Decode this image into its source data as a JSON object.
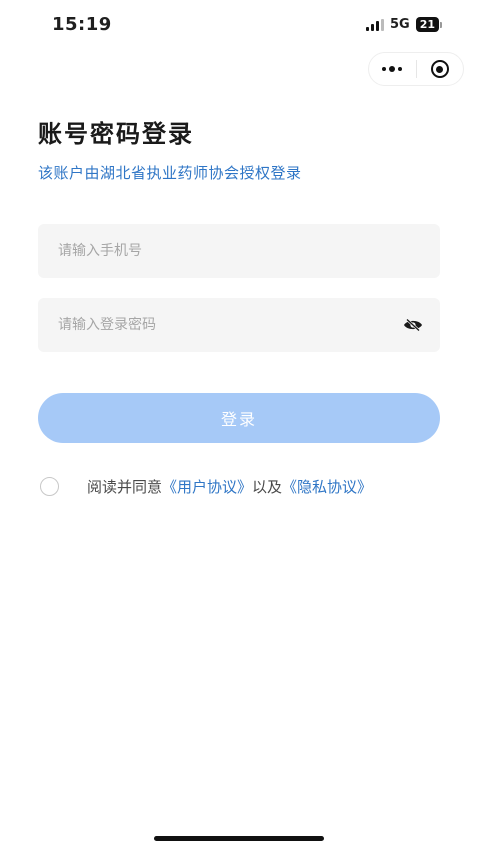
{
  "status_bar": {
    "time": "15:19",
    "network": "5G",
    "battery": "21"
  },
  "capsule": {
    "more_icon": "more-dots-icon",
    "close_icon": "target-icon"
  },
  "page": {
    "title": "账号密码登录",
    "subtitle": "该账户由湖北省执业药师协会授权登录"
  },
  "form": {
    "phone_placeholder": "请输入手机号",
    "password_placeholder": "请输入登录密码",
    "password_toggle_icon": "eye-off-icon",
    "login_label": "登录"
  },
  "agreement": {
    "prefix": "阅读并同意",
    "user_agreement": "《用户协议》",
    "connector": "以及",
    "privacy_agreement": "《隐私协议》"
  },
  "colors": {
    "accent": "#2f76c6",
    "button_disabled": "#a6c9f7",
    "field_bg": "#f5f5f5"
  }
}
